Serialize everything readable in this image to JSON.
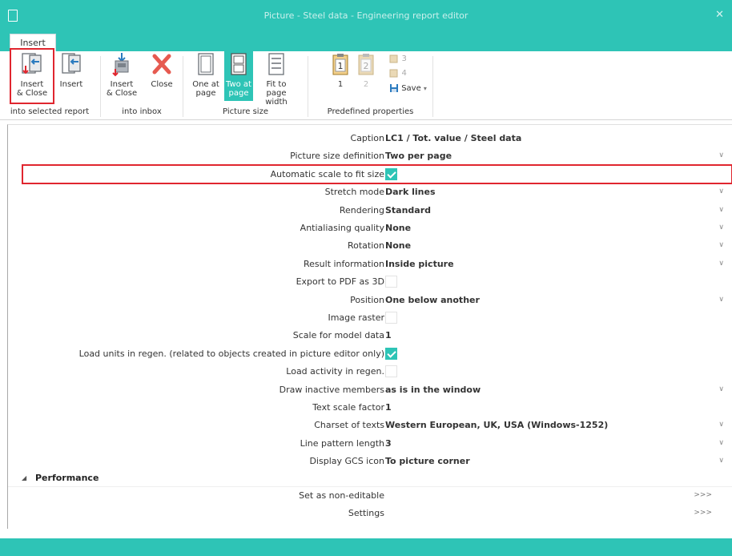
{
  "window": {
    "title": "Picture - Steel data - Engineering report editor"
  },
  "tabs": [
    {
      "label": "Insert"
    }
  ],
  "ribbon": {
    "buttons": {
      "insert_close_report": "Insert\n& Close",
      "insert_report": "Insert",
      "insert_close_inbox": "Insert\n& Close",
      "close": "Close",
      "one_at_page": "One at\npage",
      "two_at_page": "Two at\npage",
      "fit_to_page_width": "Fit to page\nwidth",
      "predef_1": "1",
      "predef_2": "2",
      "predef_3": "3",
      "predef_4": "4",
      "save": "Save"
    },
    "groups": {
      "into_selected_report": "into selected report",
      "into_inbox": "into inbox",
      "picture_size": "Picture size",
      "predefined_properties": "Predefined properties"
    }
  },
  "properties": [
    {
      "label": "Caption",
      "value": "LC1 / Tot. value / Steel data",
      "type": "text"
    },
    {
      "label": "Picture size definition",
      "value": "Two per page",
      "type": "select"
    },
    {
      "label": "Automatic scale to fit size",
      "checked": true,
      "type": "check"
    },
    {
      "label": "Stretch mode",
      "value": "Dark lines",
      "type": "select"
    },
    {
      "label": "Rendering",
      "value": "Standard",
      "type": "select"
    },
    {
      "label": "Antialiasing quality",
      "value": "None",
      "type": "select"
    },
    {
      "label": "Rotation",
      "value": "None",
      "type": "select"
    },
    {
      "label": "Result information",
      "value": "Inside picture",
      "type": "select"
    },
    {
      "label": "Export to PDF as 3D",
      "checked": false,
      "type": "check"
    },
    {
      "label": "Position",
      "value": "One below another",
      "type": "select"
    },
    {
      "label": "Image raster",
      "checked": false,
      "type": "check"
    },
    {
      "label": "Scale for model data",
      "value": "1",
      "type": "text"
    },
    {
      "label": "Load units in regen. (related to objects created in picture editor only)",
      "checked": true,
      "type": "check"
    },
    {
      "label": "Load activity in regen.",
      "checked": false,
      "type": "check"
    },
    {
      "label": "Draw inactive members",
      "value": "as is in the window",
      "type": "select"
    },
    {
      "label": "Text scale factor",
      "value": "1",
      "type": "text"
    },
    {
      "label": "Charset of texts",
      "value": "Western European, UK, USA (Windows-1252)",
      "type": "select"
    },
    {
      "label": "Line pattern length",
      "value": "3",
      "type": "select"
    },
    {
      "label": "Display GCS icon",
      "value": "To picture corner",
      "type": "select"
    }
  ],
  "performance": {
    "label": "Performance",
    "items": [
      {
        "label": "Set as non-editable",
        "action": ">>>"
      },
      {
        "label": "Settings",
        "action": ">>>"
      }
    ]
  },
  "colors": {
    "accent": "#2ec4b6",
    "highlight": "#e0262f"
  }
}
